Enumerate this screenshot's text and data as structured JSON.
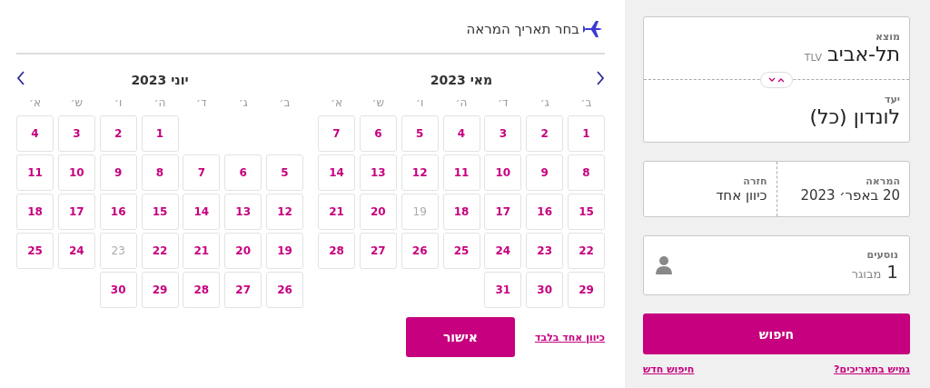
{
  "calendar": {
    "title": "בחר תאריך המראה",
    "months": [
      {
        "title": "מאי 2023",
        "kind": "prev",
        "weekdays": [
          "ב׳",
          "ג׳",
          "ד׳",
          "ה׳",
          "ו׳",
          "ש׳",
          "א׳"
        ],
        "days": [
          {
            "kind": "day",
            "label": "1",
            "disabled": false
          },
          {
            "kind": "day",
            "label": "2",
            "disabled": false
          },
          {
            "kind": "day",
            "label": "3",
            "disabled": false
          },
          {
            "kind": "day",
            "label": "4",
            "disabled": false
          },
          {
            "kind": "day",
            "label": "5",
            "disabled": false
          },
          {
            "kind": "day",
            "label": "6",
            "disabled": false
          },
          {
            "kind": "day",
            "label": "7",
            "disabled": false
          },
          {
            "kind": "day",
            "label": "8",
            "disabled": false
          },
          {
            "kind": "day",
            "label": "9",
            "disabled": false
          },
          {
            "kind": "day",
            "label": "10",
            "disabled": false
          },
          {
            "kind": "day",
            "label": "11",
            "disabled": false
          },
          {
            "kind": "day",
            "label": "12",
            "disabled": false
          },
          {
            "kind": "day",
            "label": "13",
            "disabled": false
          },
          {
            "kind": "day",
            "label": "14",
            "disabled": false
          },
          {
            "kind": "day",
            "label": "15",
            "disabled": false
          },
          {
            "kind": "day",
            "label": "16",
            "disabled": false
          },
          {
            "kind": "day",
            "label": "17",
            "disabled": false
          },
          {
            "kind": "day",
            "label": "18",
            "disabled": false
          },
          {
            "kind": "day",
            "label": "19",
            "disabled": true
          },
          {
            "kind": "day",
            "label": "20",
            "disabled": false
          },
          {
            "kind": "day",
            "label": "21",
            "disabled": false
          },
          {
            "kind": "day",
            "label": "22",
            "disabled": false
          },
          {
            "kind": "day",
            "label": "23",
            "disabled": false
          },
          {
            "kind": "day",
            "label": "24",
            "disabled": false
          },
          {
            "kind": "day",
            "label": "25",
            "disabled": false
          },
          {
            "kind": "day",
            "label": "26",
            "disabled": false
          },
          {
            "kind": "day",
            "label": "27",
            "disabled": false
          },
          {
            "kind": "day",
            "label": "28",
            "disabled": false
          },
          {
            "kind": "day",
            "label": "29",
            "disabled": false
          },
          {
            "kind": "day",
            "label": "30",
            "disabled": false
          },
          {
            "kind": "day",
            "label": "31",
            "disabled": false
          }
        ]
      },
      {
        "title": "יוני 2023",
        "kind": "next",
        "weekdays": [
          "ב׳",
          "ג׳",
          "ד׳",
          "ה׳",
          "ו׳",
          "ש׳",
          "א׳"
        ],
        "days": [
          {
            "kind": "blank"
          },
          {
            "kind": "blank"
          },
          {
            "kind": "blank"
          },
          {
            "kind": "day",
            "label": "1",
            "disabled": false
          },
          {
            "kind": "day",
            "label": "2",
            "disabled": false
          },
          {
            "kind": "day",
            "label": "3",
            "disabled": false
          },
          {
            "kind": "day",
            "label": "4",
            "disabled": false
          },
          {
            "kind": "day",
            "label": "5",
            "disabled": false
          },
          {
            "kind": "day",
            "label": "6",
            "disabled": false
          },
          {
            "kind": "day",
            "label": "7",
            "disabled": false
          },
          {
            "kind": "day",
            "label": "8",
            "disabled": false
          },
          {
            "kind": "day",
            "label": "9",
            "disabled": false
          },
          {
            "kind": "day",
            "label": "10",
            "disabled": false
          },
          {
            "kind": "day",
            "label": "11",
            "disabled": false
          },
          {
            "kind": "day",
            "label": "12",
            "disabled": false
          },
          {
            "kind": "day",
            "label": "13",
            "disabled": false
          },
          {
            "kind": "day",
            "label": "14",
            "disabled": false
          },
          {
            "kind": "day",
            "label": "15",
            "disabled": false
          },
          {
            "kind": "day",
            "label": "16",
            "disabled": false
          },
          {
            "kind": "day",
            "label": "17",
            "disabled": false
          },
          {
            "kind": "day",
            "label": "18",
            "disabled": false
          },
          {
            "kind": "day",
            "label": "19",
            "disabled": false
          },
          {
            "kind": "day",
            "label": "20",
            "disabled": false
          },
          {
            "kind": "day",
            "label": "21",
            "disabled": false
          },
          {
            "kind": "day",
            "label": "22",
            "disabled": false
          },
          {
            "kind": "day",
            "label": "23",
            "disabled": true
          },
          {
            "kind": "day",
            "label": "24",
            "disabled": false
          },
          {
            "kind": "day",
            "label": "25",
            "disabled": false
          },
          {
            "kind": "day",
            "label": "26",
            "disabled": false
          },
          {
            "kind": "day",
            "label": "27",
            "disabled": false
          },
          {
            "kind": "day",
            "label": "28",
            "disabled": false
          },
          {
            "kind": "day",
            "label": "29",
            "disabled": false
          },
          {
            "kind": "day",
            "label": "30",
            "disabled": false
          }
        ]
      }
    ],
    "confirm_button": "אישור",
    "one_way_link": "כיוון אחד בלבד"
  },
  "search": {
    "origin": {
      "label": "מוצא",
      "city": "תל-אביב",
      "code": "TLV"
    },
    "destination": {
      "label": "יעד",
      "city": "לונדון (כל)"
    },
    "departure": {
      "label": "המראה",
      "value": "20 באפר׳ 2023"
    },
    "return": {
      "label": "חזרה",
      "value": "כיוון אחד"
    },
    "passengers": {
      "label": "נוסעים",
      "count": "1",
      "type": "מבוגר"
    },
    "search_button": "חיפוש",
    "links": [
      "גמיש בתאריכים?",
      "חיפוש חדש"
    ]
  }
}
